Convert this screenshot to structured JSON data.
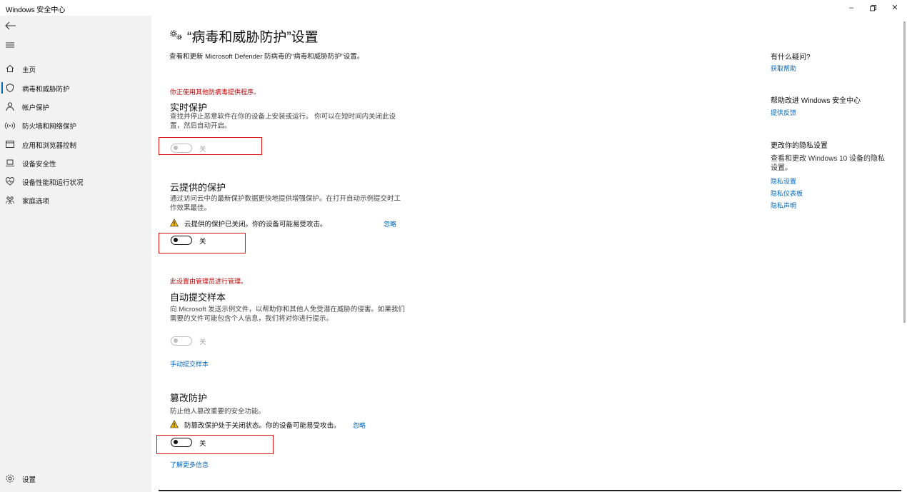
{
  "window": {
    "title": "Windows 安全中心",
    "minimize": "–",
    "maximize": "□",
    "close": "✕"
  },
  "sidebar": {
    "items": [
      {
        "label": "主页",
        "icon": "home-icon"
      },
      {
        "label": "病毒和威胁防护",
        "icon": "shield-icon"
      },
      {
        "label": "帐户保护",
        "icon": "person-icon"
      },
      {
        "label": "防火墙和网络保护",
        "icon": "wifi-icon"
      },
      {
        "label": "应用和浏览器控制",
        "icon": "browser-icon"
      },
      {
        "label": "设备安全性",
        "icon": "laptop-icon"
      },
      {
        "label": "设备性能和运行状况",
        "icon": "heart-icon"
      },
      {
        "label": "家庭选项",
        "icon": "family-icon"
      }
    ],
    "settings_label": "设置"
  },
  "page": {
    "title": "“病毒和威胁防护”设置",
    "subtitle": "查看和更新 Microsoft Defender 防病毒的“病毒和威胁防护”设置。"
  },
  "realtime": {
    "note": "你正使用其他防病毒提供程序。",
    "title": "实时保护",
    "desc": "查找并停止恶意软件在你的设备上安装或运行。 你可以在短时间内关闭此设置，然后自动开启。",
    "toggle_label": "关"
  },
  "cloud": {
    "title": "云提供的保护",
    "desc": "通过访问云中的最新保护数据更快地提供增强保护。在打开自动示例提交时工作效果最佳。",
    "warning": "云提供的保护已关闭。你的设备可能易受攻击。",
    "dismiss": "忽略",
    "toggle_label": "关"
  },
  "sample": {
    "note": "此设置由管理员进行管理。",
    "title": "自动提交样本",
    "desc": "向 Microsoft 发送示例文件，以帮助你和其他人免受潜在威胁的侵害。如果我们需要的文件可能包含个人信息，我们将对你进行提示。",
    "toggle_label": "关",
    "link": "手动提交样本"
  },
  "tamper": {
    "title": "篡改防护",
    "desc": "防止他人篡改重要的安全功能。",
    "warning": "防篡改保护处于关闭状态。你的设备可能易受攻击。",
    "dismiss": "忽略",
    "toggle_label": "关",
    "link": "了解更多信息"
  },
  "aside": {
    "question_head": "有什么疑问?",
    "get_help": "获取帮助",
    "improve_head": "帮助改进 Windows 安全中心",
    "feedback": "提供反馈",
    "privacy_head": "更改你的隐私设置",
    "privacy_text": "查看和更改 Windows 10 设备的隐私设置。",
    "privacy_settings": "隐私设置",
    "privacy_dashboard": "隐私仪表板",
    "privacy_statement": "隐私声明"
  },
  "colors": {
    "accent": "#0067c0",
    "warning_red": "#c00000",
    "highlight_box": "#e01010",
    "sidebar_bg": "#f2f2f2"
  }
}
